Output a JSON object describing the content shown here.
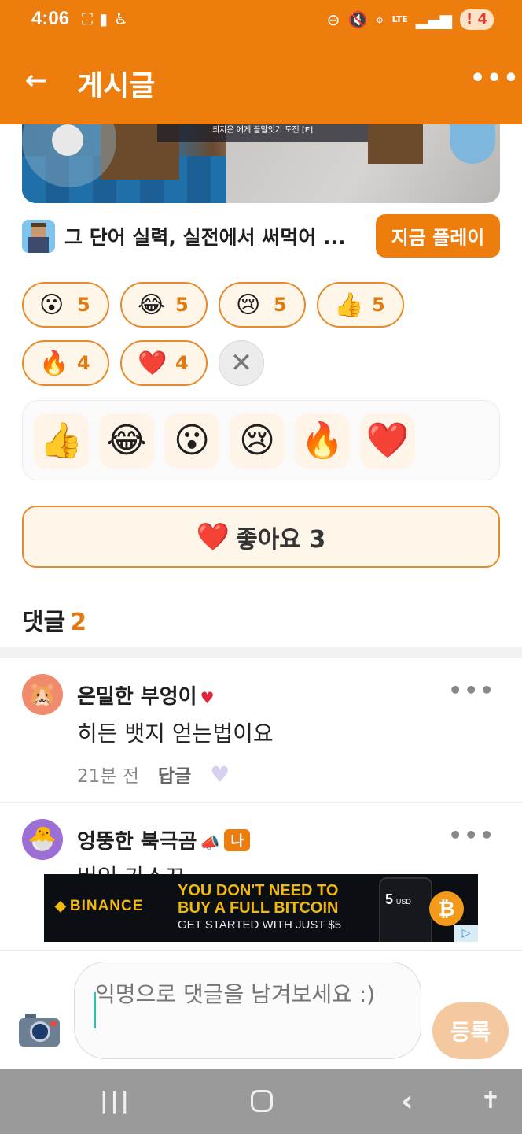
{
  "status_bar": {
    "time": "4:06",
    "left_icons": [
      "screenshot-icon",
      "battery-saver-icon",
      "accessibility-icon"
    ],
    "right_icons": [
      "dnd-icon",
      "mute-icon",
      "location-icon",
      "lte-icon",
      "signal-icon"
    ],
    "lte_label": "LTE",
    "notification_badge": "4"
  },
  "app_bar": {
    "title": "게시글"
  },
  "game": {
    "caption": "최지은 에게 끝말잇기 도전 [E]",
    "title": "그 단어 실력, 실전에서 써먹어 ...",
    "play_label": "지금 플레이"
  },
  "reactions": [
    {
      "emoji": "😮",
      "count": "5"
    },
    {
      "emoji": "😂",
      "count": "5"
    },
    {
      "emoji": "😢",
      "count": "5"
    },
    {
      "emoji": "👍",
      "count": "5"
    },
    {
      "emoji": "🔥",
      "count": "4"
    },
    {
      "emoji": "❤️",
      "count": "4"
    }
  ],
  "close_label": "✕",
  "emoji_picker": [
    "👍",
    "😂",
    "😮",
    "😢",
    "🔥",
    "❤️"
  ],
  "like": {
    "emoji": "❤️",
    "label": "좋아요 3"
  },
  "comments_section": {
    "label": "댓글",
    "count": "2"
  },
  "comments": [
    {
      "avatar": "🐹",
      "avatar_color": "#f08a6d",
      "author": "은밀한 부엉이",
      "badge": "♥",
      "body": "히든 뱃지 얻는법이요",
      "time": "21분 전",
      "reply_label": "답글"
    },
    {
      "avatar": "🐣",
      "avatar_color": "#9b6fd6",
      "author": "엉뚱한 북극곰",
      "badge": "📣",
      "me_label": "나",
      "body_partial": "버인 가스끄"
    }
  ],
  "ad": {
    "brand": "BINANCE",
    "headline_1": "YOU DON'T NEED TO",
    "headline_2": "BUY A FULL BITCOIN",
    "sub": "GET STARTED WITH JUST $5",
    "phone_value": "5",
    "phone_unit": "USD",
    "coin": "₿"
  },
  "input": {
    "placeholder": "익명으로 댓글을 남겨보세요 :)",
    "submit_label": "등록"
  },
  "colors": {
    "brand": "#ed7d0c",
    "chip_border": "#e58a2d",
    "chip_bg": "#fff6ea"
  }
}
